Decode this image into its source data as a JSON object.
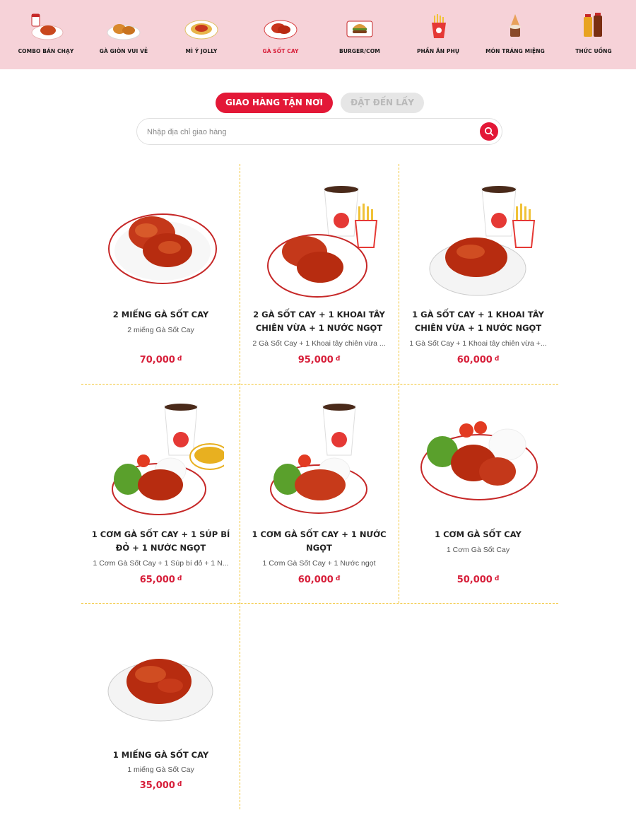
{
  "categories": [
    {
      "label": "COMBO BÁN CHẠY",
      "icon": "combo-meal-icon",
      "active": false
    },
    {
      "label": "GÀ GIÒN VUI VẺ",
      "icon": "fried-chicken-icon",
      "active": false
    },
    {
      "label": "MÌ Ý JOLLY",
      "icon": "spaghetti-icon",
      "active": false
    },
    {
      "label": "GÀ SỐT CAY",
      "icon": "spicy-chicken-icon",
      "active": true
    },
    {
      "label": "BURGER/CƠM",
      "icon": "burger-icon",
      "active": false
    },
    {
      "label": "PHẦN ĂN PHỤ",
      "icon": "fries-icon",
      "active": false
    },
    {
      "label": "MÓN TRÁNG MIỆNG",
      "icon": "dessert-icon",
      "active": false
    },
    {
      "label": "THỨC UỐNG",
      "icon": "drinks-icon",
      "active": false
    }
  ],
  "delivery_tabs": {
    "delivery_label": "GIAO HÀNG TẬN NƠI",
    "pickup_label": "ĐẶT ĐẾN LẤY",
    "active": "delivery"
  },
  "search": {
    "placeholder": "Nhập địa chỉ giao hàng",
    "value": "",
    "icon": "search-icon"
  },
  "currency": "đ",
  "products": [
    {
      "title": "2 MIẾNG GÀ SỐT CAY",
      "desc": "2 miếng Gà Sốt Cay",
      "price": "70,000",
      "image": "two-spicy-chicken-plate"
    },
    {
      "title": "2 GÀ SỐT CAY + 1 KHOAI TÂY CHIÊN VỪA + 1 NƯỚC NGỌT",
      "desc": "2 Gà Sốt Cay + 1 Khoai tây chiên vừa ...",
      "price": "95,000",
      "image": "two-chicken-fries-drink-combo"
    },
    {
      "title": "1 GÀ SỐT CAY + 1 KHOAI TÂY CHIÊN VỪA + 1 NƯỚC NGỌT",
      "desc": "1 Gà Sốt Cay + 1 Khoai tây chiên vừa +...",
      "price": "60,000",
      "image": "one-chicken-fries-drink-combo"
    },
    {
      "title": "1 CƠM GÀ SỐT CAY + 1 SÚP BÍ ĐỎ + 1 NƯỚC NGỌT",
      "desc": "1 Cơm Gà Sốt Cay + 1 Súp bí đỏ + 1 N...",
      "price": "65,000",
      "image": "chicken-rice-soup-drink-combo"
    },
    {
      "title": "1 CƠM GÀ SỐT CAY + 1 NƯỚC NGỌT",
      "desc": "1 Cơm Gà Sốt Cay + 1 Nước ngọt",
      "price": "60,000",
      "image": "chicken-rice-drink-combo"
    },
    {
      "title": "1 CƠM GÀ SỐT CAY",
      "desc": "1 Cơm Gà Sốt Cay",
      "price": "50,000",
      "image": "chicken-rice-plate"
    },
    {
      "title": "1 MIẾNG GÀ SỐT CAY",
      "desc": "1 miếng Gà Sốt Cay",
      "price": "35,000",
      "image": "one-spicy-chicken-plate"
    }
  ],
  "colors": {
    "brand_red": "#e31837",
    "nav_background": "#f6d2d8",
    "grid_line": "#f2c431",
    "price": "#d71f3a"
  }
}
